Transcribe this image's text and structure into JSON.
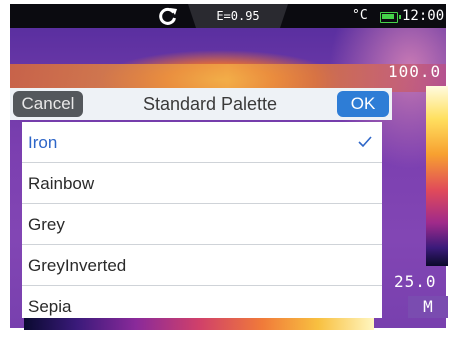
{
  "status": {
    "emissivity": "E=0.95",
    "unit": "°C",
    "time": "12:00",
    "battery_color": "#45d24a"
  },
  "scale": {
    "max": "100.0",
    "min": "25.0",
    "mode": "M"
  },
  "dialog": {
    "cancel_label": "Cancel",
    "title": "Standard Palette",
    "ok_label": "OK",
    "items": [
      {
        "label": "Iron",
        "selected": true
      },
      {
        "label": "Rainbow",
        "selected": false
      },
      {
        "label": "Grey",
        "selected": false
      },
      {
        "label": "GreyInverted",
        "selected": false
      },
      {
        "label": "Sepia",
        "selected": false
      }
    ]
  },
  "colors": {
    "accent": "#2e7dd6",
    "selected_text": "#2e66c8",
    "cancel_bg": "#54585c"
  },
  "icons": {
    "refresh": "refresh-icon",
    "check": "check-icon",
    "battery": "battery-icon"
  }
}
